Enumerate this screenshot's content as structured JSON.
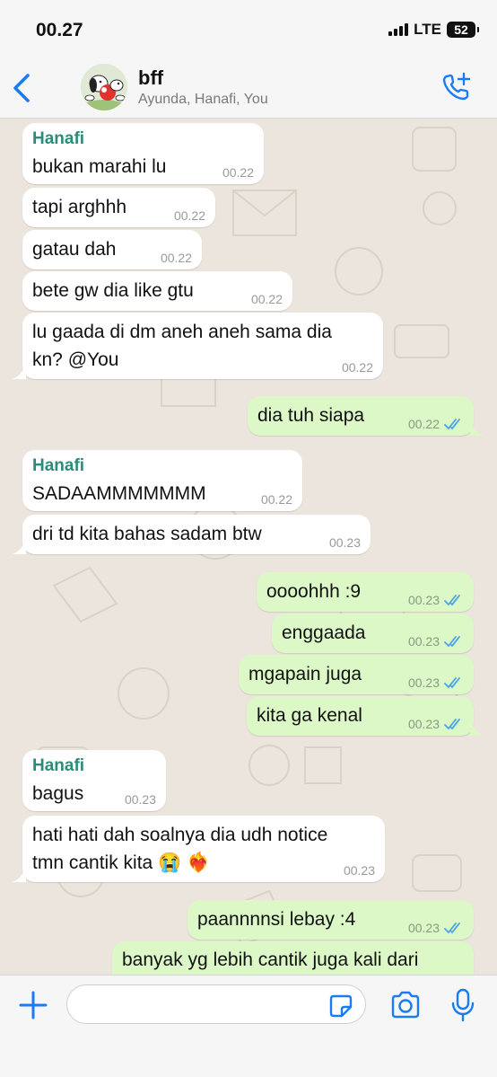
{
  "status_bar": {
    "time": "00.27",
    "network": "LTE",
    "battery": "52"
  },
  "header": {
    "title": "bff",
    "subtitle": "Ayunda, Hanafi, You"
  },
  "messages": [
    {
      "sender": "Hanafi",
      "lines": [
        "bukan marahi lu"
      ],
      "time": "00.22"
    },
    {
      "lines": [
        "tapi arghhh"
      ],
      "time": "00.22"
    },
    {
      "lines": [
        "gatau dah"
      ],
      "time": "00.22"
    },
    {
      "lines": [
        "bete gw dia like gtu"
      ],
      "time": "00.22"
    },
    {
      "lines": [
        "lu gaada di dm aneh aneh sama dia",
        "kn? @You"
      ],
      "time": "00.22"
    },
    {
      "lines": [
        "dia tuh siapa"
      ],
      "time": "00.22"
    },
    {
      "sender": "Hanafi",
      "lines": [
        "SADAAMMMMMMM"
      ],
      "time": "00.22"
    },
    {
      "lines": [
        "dri td kita bahas sadam btw"
      ],
      "time": "00.23"
    },
    {
      "lines": [
        "oooohhh :9"
      ],
      "time": "00.23"
    },
    {
      "lines": [
        "enggaada"
      ],
      "time": "00.23"
    },
    {
      "lines": [
        "mgapain juga"
      ],
      "time": "00.23"
    },
    {
      "lines": [
        "kita ga kenal"
      ],
      "time": "00.23"
    },
    {
      "sender": "Hanafi",
      "lines": [
        "bagus"
      ],
      "time": "00.23"
    },
    {
      "lines": [
        "hati hati dah soalnya dia udh notice",
        "tmn cantik kita 😭 ❤️‍🔥"
      ],
      "time": "00.23"
    },
    {
      "lines": [
        "paannnnsi lebay :4"
      ],
      "time": "00.23"
    },
    {
      "lines": [
        "banyak yg lebih cantik juga kali dari"
      ],
      "time": ""
    }
  ],
  "input": {
    "placeholder": ""
  },
  "colors": {
    "accent": "#1a7cf3",
    "incoming": "#ffffff",
    "outgoing": "#dcf8c6",
    "sender_name": "#2e8b7a"
  },
  "icons": [
    "back-chevron-icon",
    "add-call-icon",
    "plus-icon",
    "sticker-icon",
    "camera-icon",
    "microphone-icon",
    "double-check-icon"
  ]
}
